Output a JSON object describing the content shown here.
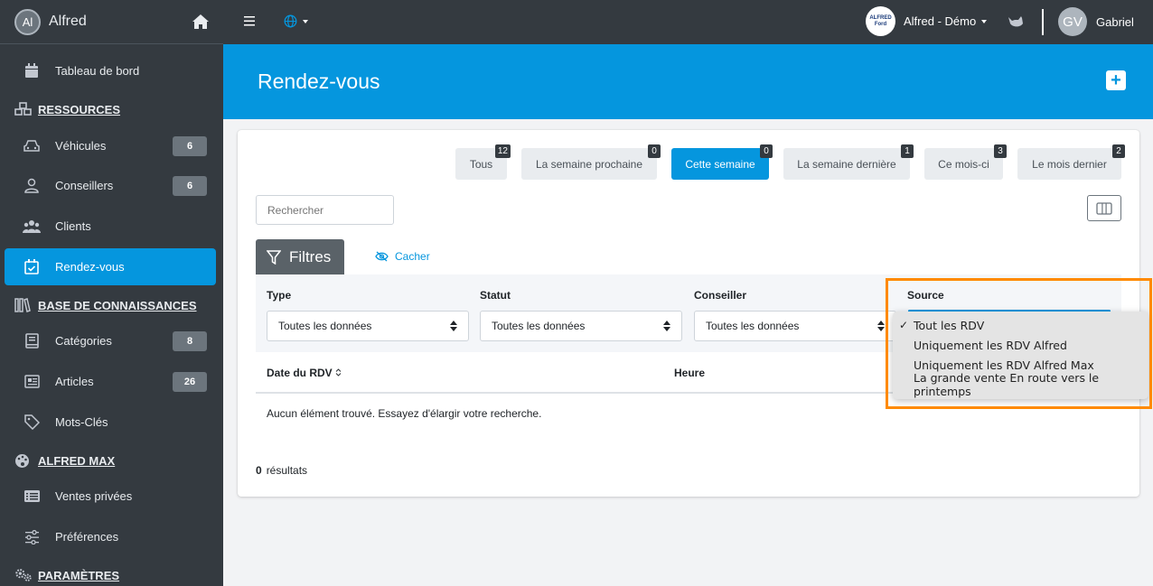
{
  "app": {
    "logo_initials": "Al",
    "name": "Alfred"
  },
  "sidebar": {
    "items": [
      {
        "label": "Tableau de bord",
        "icon": "calendar-icon"
      },
      {
        "label": "Véhicules",
        "icon": "car-icon",
        "badge": "6"
      },
      {
        "label": "Conseillers",
        "icon": "user-icon",
        "badge": "6"
      },
      {
        "label": "Clients",
        "icon": "users-icon"
      },
      {
        "label": "Rendez-vous",
        "icon": "calendar-check-icon",
        "active": true
      },
      {
        "label": "Catégories",
        "icon": "book-icon",
        "badge": "8"
      },
      {
        "label": "Articles",
        "icon": "newspaper-icon",
        "badge": "26"
      },
      {
        "label": "Mots-Clés",
        "icon": "tag-icon"
      },
      {
        "label": "Ventes privées",
        "icon": "list-icon"
      },
      {
        "label": "Préférences",
        "icon": "sliders-icon"
      }
    ],
    "sections": [
      {
        "label": "RESSOURCES",
        "icon": "cubes-icon"
      },
      {
        "label": "BASE DE CONNAISSANCES",
        "icon": "library-icon"
      },
      {
        "label": "ALFRED MAX",
        "icon": "palette-icon"
      },
      {
        "label": "PARAMÈTRES",
        "icon": "cogs-icon"
      }
    ]
  },
  "topbar": {
    "dealer_logo_text": "ALFRED Ford",
    "dealer_name": "Alfred - Démo",
    "user_initials": "GV",
    "user_name": "Gabriel"
  },
  "page": {
    "title": "Rendez-vous"
  },
  "period_tabs": [
    {
      "label": "Tous",
      "count": "12"
    },
    {
      "label": "La semaine prochaine",
      "count": "0"
    },
    {
      "label": "Cette semaine",
      "count": "0",
      "active": true
    },
    {
      "label": "La semaine dernière",
      "count": "1"
    },
    {
      "label": "Ce mois-ci",
      "count": "3"
    },
    {
      "label": "Le mois dernier",
      "count": "2"
    }
  ],
  "search": {
    "placeholder": "Rechercher"
  },
  "filters": {
    "button_label": "Filtres",
    "hide_label": "Cacher",
    "fields": [
      {
        "label": "Type",
        "value": "Toutes les données"
      },
      {
        "label": "Statut",
        "value": "Toutes les données"
      },
      {
        "label": "Conseiller",
        "value": "Toutes les données"
      },
      {
        "label": "Source",
        "value": "Tout les RDV"
      }
    ]
  },
  "table": {
    "headers": [
      "Date du RDV",
      "Heure"
    ],
    "empty_message": "Aucun élément trouvé. Essayez d'élargir votre recherche.",
    "results_count": "0",
    "results_label": "résultats"
  },
  "source_dropdown": {
    "selected": "Tout les RDV",
    "options": [
      "Tout les RDV",
      "Uniquement les RDV Alfred",
      "Uniquement les RDV Alfred Max",
      "La grande vente En route vers le printemps"
    ]
  },
  "colors": {
    "primary": "#0596de",
    "sidebar": "#343a40",
    "highlight": "#ff8a00"
  }
}
